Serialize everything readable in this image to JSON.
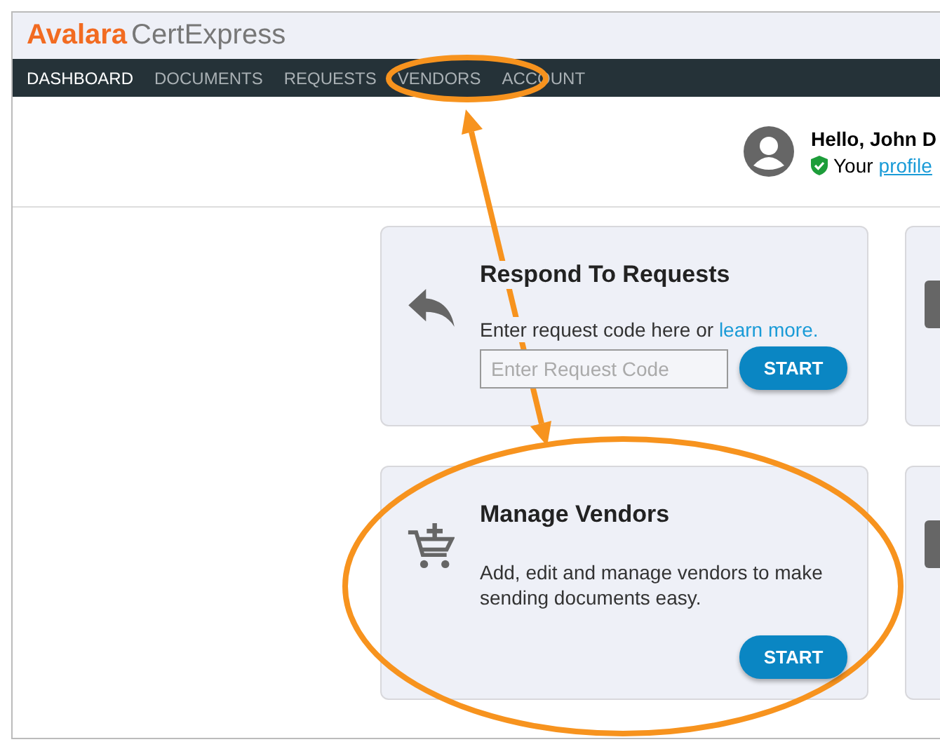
{
  "logo": {
    "brand": "Avalara",
    "product": "CertExpress"
  },
  "nav": [
    {
      "label": "DASHBOARD",
      "selected": true
    },
    {
      "label": "DOCUMENTS",
      "selected": false
    },
    {
      "label": "REQUESTS",
      "selected": false
    },
    {
      "label": "VENDORS",
      "selected": false
    },
    {
      "label": "ACCOUNT",
      "selected": false
    }
  ],
  "user": {
    "greeting": "Hello, John D",
    "status_prefix": "Your",
    "profile_link": "profile"
  },
  "cards": [
    {
      "kind": "request",
      "title": "Respond To Requests",
      "text": "Enter request code here or",
      "link": "learn more.",
      "placeholder": "Enter Request Code",
      "button": "START"
    },
    {
      "kind": "vendors",
      "title": "Manage Vendors",
      "text": "Add, edit and manage vendors to make sending documents easy.",
      "button": "START"
    }
  ]
}
